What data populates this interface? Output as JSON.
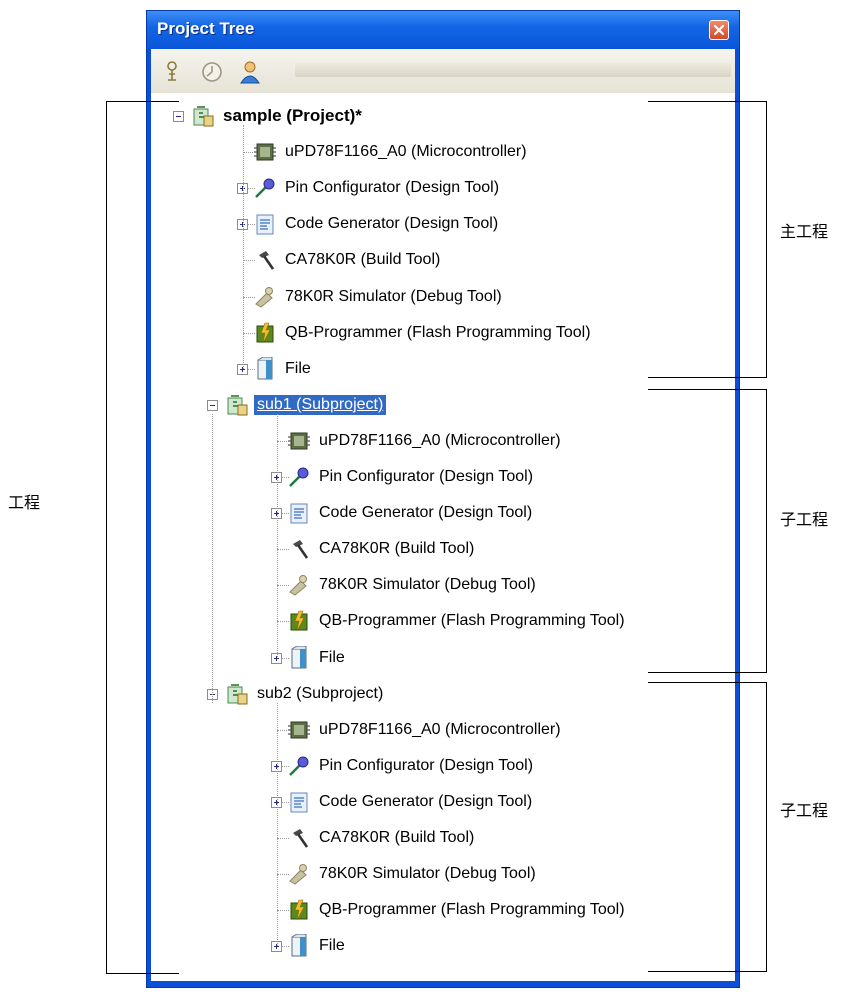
{
  "window": {
    "title": "Project Tree"
  },
  "toolbar": {
    "icons": [
      "pin-icon",
      "clock-icon",
      "person-icon"
    ]
  },
  "tree": {
    "main": {
      "label": "sample (Project)*",
      "children": [
        "uPD78F1166_A0 (Microcontroller)",
        "Pin Configurator (Design Tool)",
        "Code Generator (Design Tool)",
        "CA78K0R (Build Tool)",
        "78K0R Simulator (Debug Tool)",
        "QB-Programmer (Flash Programming Tool)",
        "File"
      ]
    },
    "sub1": {
      "label": "sub1 (Subproject)",
      "children": [
        "uPD78F1166_A0 (Microcontroller)",
        "Pin Configurator (Design Tool)",
        "Code Generator (Design Tool)",
        "CA78K0R (Build Tool)",
        "78K0R Simulator (Debug Tool)",
        "QB-Programmer (Flash Programming Tool)",
        "File"
      ]
    },
    "sub2": {
      "label": "sub2 (Subproject)",
      "children": [
        "uPD78F1166_A0 (Microcontroller)",
        "Pin Configurator (Design Tool)",
        "Code Generator (Design Tool)",
        "CA78K0R (Build Tool)",
        "78K0R Simulator (Debug Tool)",
        "QB-Programmer (Flash Programming Tool)",
        "File"
      ]
    }
  },
  "annotations": {
    "project": "工程",
    "main_project": "主工程",
    "subproject_1": "子工程",
    "subproject_2": "子工程"
  }
}
